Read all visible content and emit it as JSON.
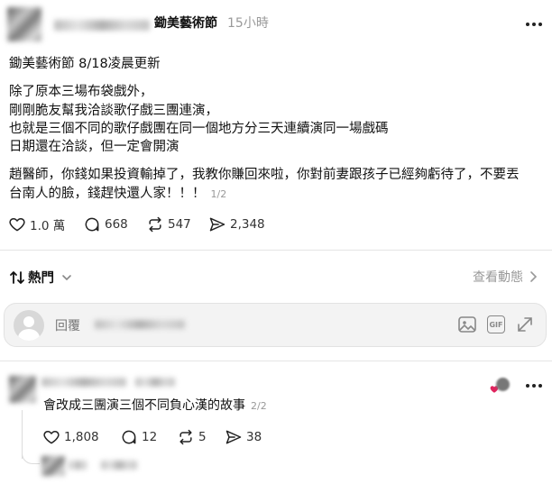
{
  "post": {
    "author_name": "鋤美藝術節",
    "time": "15小時",
    "lines": [
      "鋤美藝術節 8/18凌晨更新",
      "除了原本三場布袋戲外，",
      "剛剛脆友幫我洽談歌仔戲三團連演，",
      "也就是三個不同的歌仔戲團在同一個地方分三天連續演同一場戲碼",
      "日期還在洽談，但一定會開演",
      "趙醫師，你錢如果投資輸掉了，我教你賺回來啦，你對前妻跟孩子已經夠虧待了，不要丟",
      "台南人的臉，錢趕快還人家！！！"
    ],
    "pager": "1/2",
    "stats": {
      "likes": "1.0 萬",
      "comments": "668",
      "reposts": "547",
      "shares": "2,348"
    }
  },
  "sort": {
    "label": "熱門",
    "activity": "查看動態"
  },
  "reply_box": {
    "placeholder": "回覆",
    "gif": "GIF"
  },
  "comment": {
    "text": "會改成三團演三個不同負心漢的故事",
    "pager": "2/2",
    "stats": {
      "likes": "1,808",
      "comments": "12",
      "reposts": "5",
      "shares": "38"
    }
  },
  "icons": [
    "more-icon",
    "heart-icon",
    "comment-icon",
    "repost-icon",
    "share-icon",
    "sort-icon",
    "chevron-down-icon",
    "chevron-right-icon",
    "image-icon",
    "gif-icon",
    "expand-icon"
  ],
  "colors": {
    "text": "#111111",
    "muted": "#999999",
    "like_badge": "#e0245e"
  }
}
